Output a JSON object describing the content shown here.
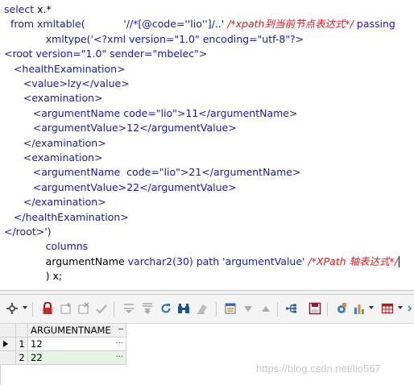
{
  "editor": {
    "lines": [
      {
        "parts": [
          {
            "t": "select ",
            "c": "kw"
          },
          {
            "t": "x.*",
            "c": "blk"
          }
        ]
      },
      {
        "parts": [
          {
            "t": "  from ",
            "c": "kw"
          },
          {
            "t": "xmltable(",
            "c": "kw"
          },
          {
            "t": "            '//*[@code=''lio'']/..' ",
            "c": "str"
          },
          {
            "t": "/*xpath到当前节点表达式*/",
            "c": "cmt"
          },
          {
            "t": " passing",
            "c": "kw"
          }
        ]
      },
      {
        "parts": [
          {
            "t": "             xmltype(",
            "c": "kw"
          },
          {
            "t": "'<?xml version=\"1.0\" encoding=\"utf-8\"?>",
            "c": "str"
          }
        ]
      },
      {
        "parts": [
          {
            "t": "<root version=\"1.0\" sender=\"mbelec\">",
            "c": "str"
          }
        ]
      },
      {
        "parts": [
          {
            "t": "   <healthExamination>",
            "c": "str"
          }
        ]
      },
      {
        "parts": [
          {
            "t": "      <value>lzy</value>",
            "c": "str"
          }
        ]
      },
      {
        "parts": [
          {
            "t": "      <examination>",
            "c": "str"
          }
        ]
      },
      {
        "parts": [
          {
            "t": "         <argumentName code=\"lio\">11</argumentName>",
            "c": "str"
          }
        ]
      },
      {
        "parts": [
          {
            "t": "         <argumentValue>12</argumentValue>",
            "c": "str"
          }
        ]
      },
      {
        "parts": [
          {
            "t": "      </examination>",
            "c": "str"
          }
        ]
      },
      {
        "parts": [
          {
            "t": "      <examination>",
            "c": "str"
          }
        ]
      },
      {
        "parts": [
          {
            "t": "         <argumentName  code=\"lio\">21</argumentName>",
            "c": "str"
          }
        ]
      },
      {
        "parts": [
          {
            "t": "         <argumentValue>22</argumentValue>",
            "c": "str"
          }
        ]
      },
      {
        "parts": [
          {
            "t": "      </examination>",
            "c": "str"
          }
        ]
      },
      {
        "parts": [
          {
            "t": "   </healthExamination>",
            "c": "str"
          }
        ]
      },
      {
        "parts": [
          {
            "t": "</root>')",
            "c": "str"
          }
        ]
      },
      {
        "parts": [
          {
            "t": "             columns",
            "c": "kw"
          }
        ]
      },
      {
        "parts": [
          {
            "t": "             argumentName ",
            "c": "blk"
          },
          {
            "t": "varchar2(30) ",
            "c": "kw"
          },
          {
            "t": "path ",
            "c": "kw"
          },
          {
            "t": "'argumentValue' ",
            "c": "str"
          },
          {
            "t": "/*XPath 轴表达式*/",
            "c": "cmt"
          }
        ]
      },
      {
        "parts": [
          {
            "t": "             ) x;",
            "c": "blk"
          }
        ]
      }
    ]
  },
  "toolbar": {
    "icons": [
      "settings-icon",
      "lock-icon",
      "add-record-icon",
      "delete-record-icon",
      "post-icon",
      "filter-down-icon",
      "filter-all-icon",
      "refresh-icon",
      "find-icon",
      "clear-icon",
      "single-record-view-icon",
      "sort-down-icon",
      "sort-up-icon",
      "query-by-example-icon",
      "save-icon",
      "print-icon",
      "chart-icon",
      "export-grid-icon"
    ]
  },
  "grid": {
    "header": "ARGUMENTNAME",
    "rows": [
      {
        "num": "1",
        "value": "12",
        "current": true
      },
      {
        "num": "2",
        "value": "22",
        "current": false
      }
    ]
  },
  "watermark": "https://blog.csdn.net/lio567",
  "colors": {
    "keyword": "#1a1aa6",
    "comment": "#e0191b",
    "text": "#000000"
  }
}
